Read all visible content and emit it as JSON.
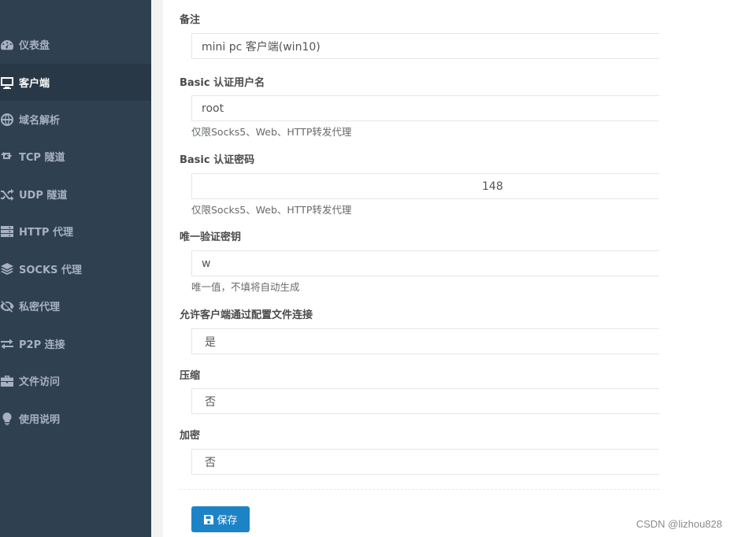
{
  "sidebar": {
    "items": [
      {
        "label": "仪表盘",
        "icon": "dashboard-icon"
      },
      {
        "label": "客户端",
        "icon": "desktop-icon",
        "active": true
      },
      {
        "label": "域名解析",
        "icon": "globe-icon"
      },
      {
        "label": "TCP 隧道",
        "icon": "retweet-icon"
      },
      {
        "label": "UDP 隧道",
        "icon": "random-icon"
      },
      {
        "label": "HTTP 代理",
        "icon": "server-icon"
      },
      {
        "label": "SOCKS 代理",
        "icon": "layers-icon"
      },
      {
        "label": "私密代理",
        "icon": "eye-slash-icon"
      },
      {
        "label": "P2P 连接",
        "icon": "exchange-icon"
      },
      {
        "label": "文件访问",
        "icon": "briefcase-icon"
      },
      {
        "label": "使用说明",
        "icon": "lightbulb-icon"
      }
    ]
  },
  "form": {
    "remark": {
      "label": "备注",
      "value": "mini pc 客户端(win10)"
    },
    "basic_user": {
      "label": "Basic 认证用户名",
      "value": "root",
      "help": "仅限Socks5、Web、HTTP转发代理"
    },
    "basic_pass": {
      "label": "Basic 认证密码",
      "value": "148",
      "help": "仅限Socks5、Web、HTTP转发代理"
    },
    "unique_key": {
      "label": "唯一验证密钥",
      "value": "w",
      "help": "唯一值，不填将自动生成"
    },
    "config_conn": {
      "label": "允许客户端通过配置文件连接",
      "value": "是"
    },
    "compress": {
      "label": "压缩",
      "value": "否"
    },
    "crypt": {
      "label": "加密",
      "value": "否"
    }
  },
  "buttons": {
    "save": "保存"
  },
  "watermark": "CSDN @lizhou828",
  "colors": {
    "sidebar_bg": "#2f4050",
    "sidebar_active": "#293846",
    "primary": "#1c84c6"
  }
}
